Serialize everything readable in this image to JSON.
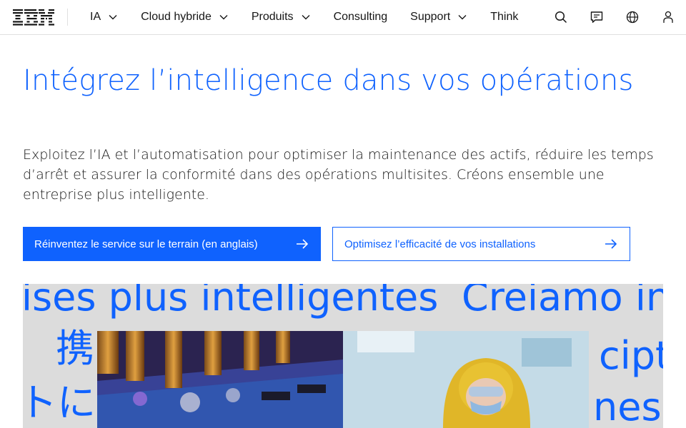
{
  "nav": {
    "logo": "IBM",
    "items": [
      {
        "label": "IA",
        "has_dropdown": true
      },
      {
        "label": "Cloud hybride",
        "has_dropdown": true
      },
      {
        "label": "Produits",
        "has_dropdown": true
      },
      {
        "label": "Consulting",
        "has_dropdown": false
      },
      {
        "label": "Support",
        "has_dropdown": true
      },
      {
        "label": "Think",
        "has_dropdown": false
      }
    ],
    "icons": [
      "search-icon",
      "chat-icon",
      "globe-icon",
      "user-icon"
    ]
  },
  "hero": {
    "title": "Intégrez l’intelligence dans vos opérations",
    "description": "Exploitez l’IA et l’automatisation pour optimiser la maintenance des actifs, réduire les temps d’arrêt et assurer la conformité dans des opérations multisites. Créons ensemble une entreprise plus intelligente.",
    "primary_button": "Réinventez le service sur le terrain (en anglais)",
    "secondary_button": "Optimisez l’efficacité de vos installations"
  },
  "media": {
    "text_1": "ises plus intelligentes",
    "text_2": "Creiamo in",
    "text_3": "携",
    "text_4": "トに",
    "text_5": "cipt",
    "text_6": "ness"
  },
  "colors": {
    "accent": "#0f62fe",
    "text": "#161616",
    "media_bg": "#dcdcdc"
  }
}
